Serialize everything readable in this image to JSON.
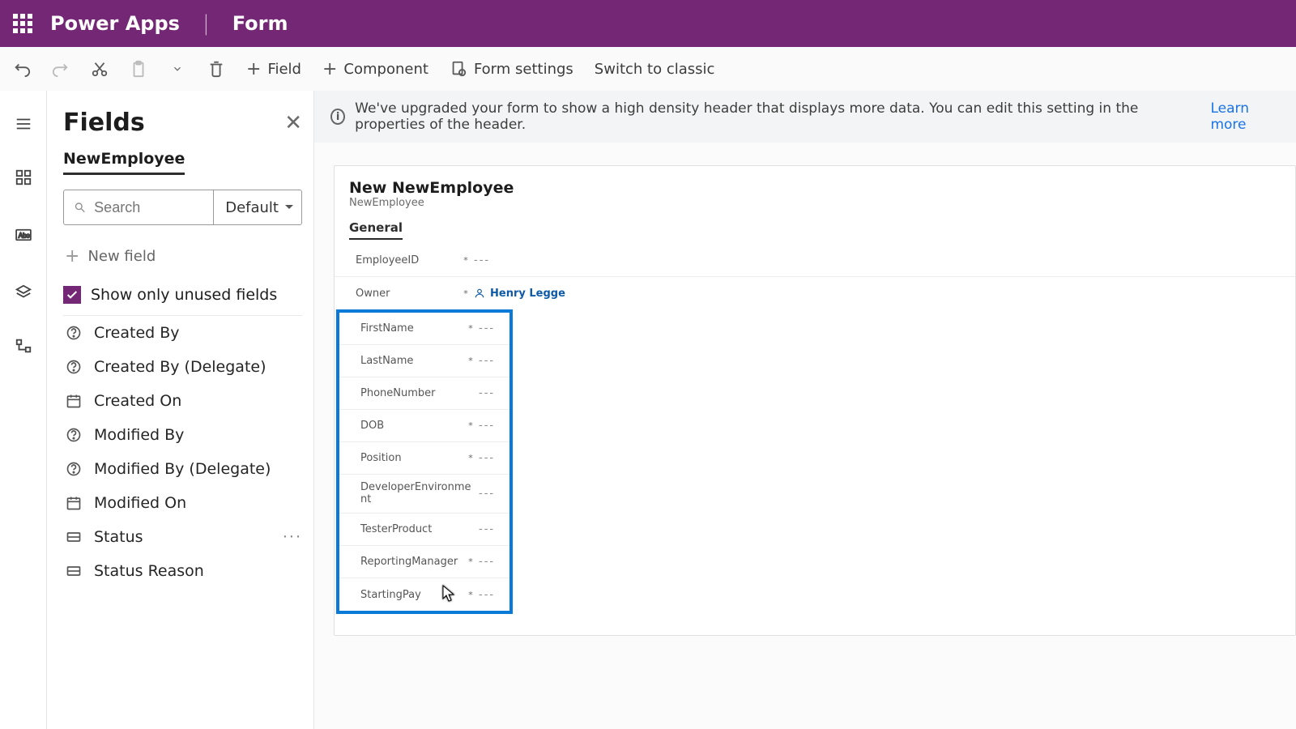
{
  "header": {
    "brand": "Power Apps",
    "divider": "|",
    "page": "Form"
  },
  "toolbar": {
    "addField": "Field",
    "addComponent": "Component",
    "formSettings": "Form settings",
    "switchClassic": "Switch to classic"
  },
  "panel": {
    "title": "Fields",
    "closeGlyph": "✕",
    "tab": "NewEmployee",
    "searchPlaceholder": "Search",
    "filterLabel": "Default",
    "newField": "New field",
    "showUnused": "Show only unused fields",
    "items": [
      {
        "icon": "question",
        "label": "Created By"
      },
      {
        "icon": "question",
        "label": "Created By (Delegate)"
      },
      {
        "icon": "date",
        "label": "Created On"
      },
      {
        "icon": "question",
        "label": "Modified By"
      },
      {
        "icon": "question",
        "label": "Modified By (Delegate)"
      },
      {
        "icon": "date",
        "label": "Modified On"
      },
      {
        "icon": "choice",
        "label": "Status",
        "more": true
      },
      {
        "icon": "choice",
        "label": "Status Reason"
      }
    ]
  },
  "infoBar": {
    "text": "We've upgraded your form to show a high density header that displays more data. You can edit this setting in the properties of the header.",
    "link": "Learn more"
  },
  "form": {
    "title": "New NewEmployee",
    "subtitle": "NewEmployee",
    "tab": "General",
    "headerRows": [
      {
        "label": "EmployeeID",
        "required": true,
        "value": "---"
      },
      {
        "label": "Owner",
        "required": true,
        "value": "Henry Legge",
        "isOwner": true
      }
    ],
    "boxRows": [
      {
        "label": "FirstName",
        "required": true,
        "value": "---"
      },
      {
        "label": "LastName",
        "required": true,
        "value": "---"
      },
      {
        "label": "PhoneNumber",
        "required": false,
        "value": "---"
      },
      {
        "label": "DOB",
        "required": true,
        "value": "---"
      },
      {
        "label": "Position",
        "required": true,
        "value": "---"
      },
      {
        "label": "DeveloperEnvironment",
        "required": false,
        "value": "---",
        "wrap": true
      },
      {
        "label": "TesterProduct",
        "required": false,
        "value": "---"
      },
      {
        "label": "ReportingManager",
        "required": true,
        "value": "---"
      },
      {
        "label": "StartingPay",
        "required": true,
        "value": "---"
      }
    ]
  }
}
